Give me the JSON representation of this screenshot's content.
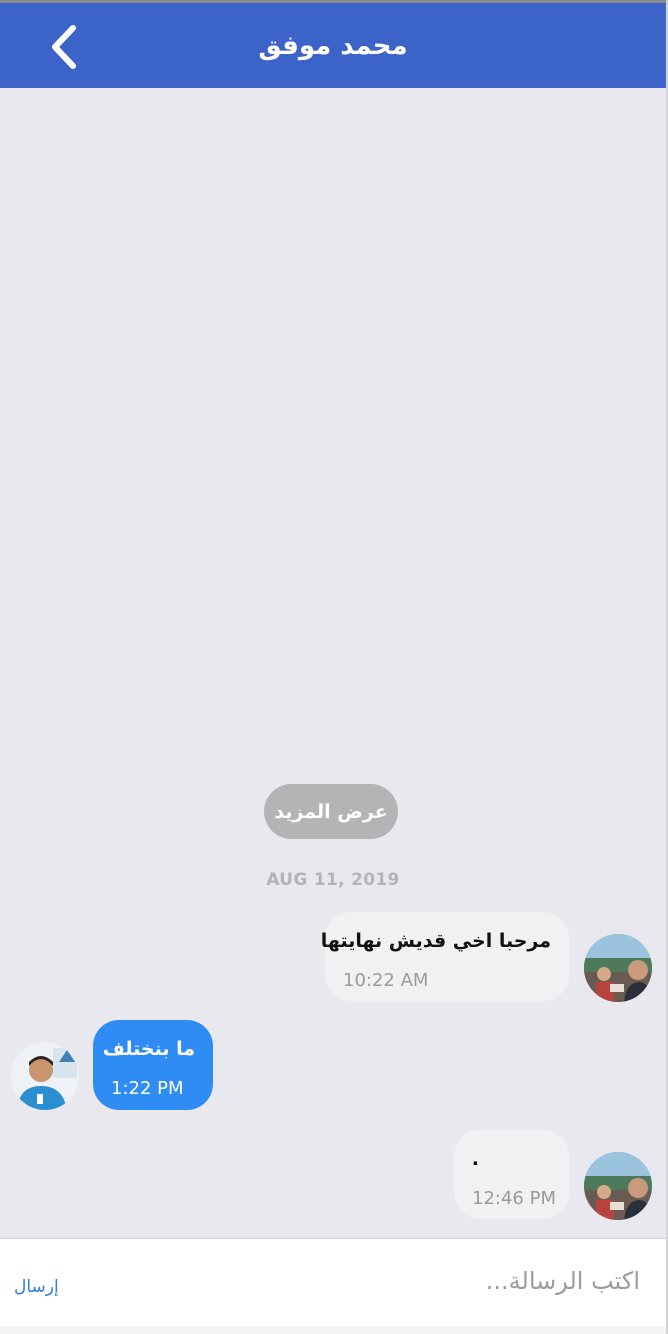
{
  "header": {
    "title": "محمد موفق"
  },
  "chat": {
    "load_more_label": "عرض المزيد",
    "date_separator": "AUG 11, 2019",
    "messages": [
      {
        "direction": "incoming",
        "text": "مرحبا اخي قديش نهايتها",
        "time": "10:22 AM"
      },
      {
        "direction": "outgoing",
        "text": "ما بنختلف",
        "time": "1:22 PM"
      },
      {
        "direction": "incoming",
        "text": ".",
        "time": "12:46 PM"
      }
    ]
  },
  "composer": {
    "placeholder": "اكتب الرسالة...",
    "value": "",
    "send_label": "إرسال"
  },
  "colors": {
    "header_bg": "#3c64c8",
    "chat_bg": "#e9e8ef",
    "incoming_bubble": "#f1f1f3",
    "outgoing_bubble": "#2f8cf4",
    "load_more_bg": "#b4b4b6",
    "send_link": "#2f7fd8"
  },
  "icons": {
    "back": "chevron-left-icon"
  }
}
